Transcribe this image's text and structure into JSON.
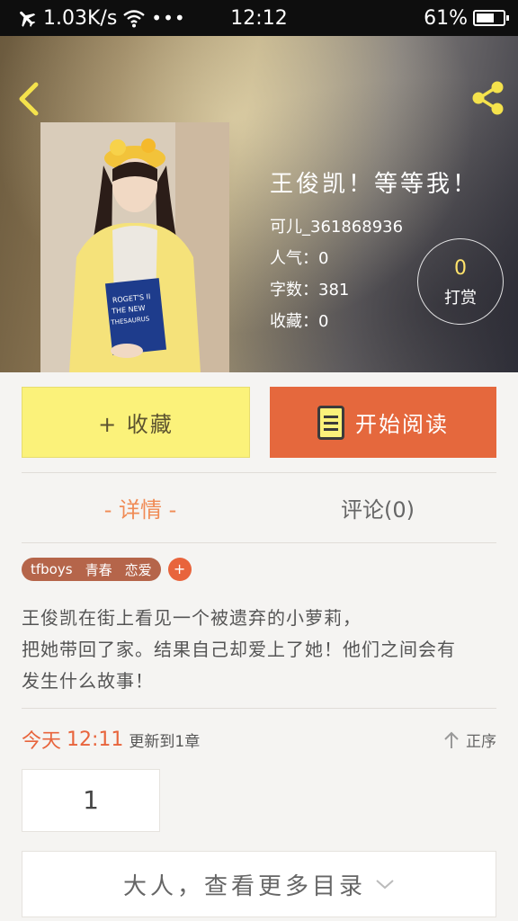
{
  "status": {
    "speed": "1.03K/s",
    "time": "12:12",
    "battery": "61%"
  },
  "book": {
    "title": "王俊凯！等等我！",
    "author": "可儿_361868936",
    "popularity": "人气：0",
    "word_count": "字数：381",
    "favorites": "收藏：0"
  },
  "tip": {
    "count": "0",
    "label": "打赏"
  },
  "actions": {
    "favorite_label": "+ 收藏",
    "read_label": "开始阅读"
  },
  "tabs": {
    "detail": "- 详情 -",
    "comments": "评论(0)"
  },
  "tags": [
    "tfboys",
    "青春",
    "恋爱"
  ],
  "tag_add": "+",
  "synopsis": [
    "王俊凯在街上看见一个被遗弃的小萝莉，",
    "把她带回了家。结果自己却爱上了她！他们之间会有",
    "发生什么故事！"
  ],
  "update": {
    "day": "今天",
    "time": "12:11",
    "text": "更新到1章",
    "order": "正序"
  },
  "page_number": "1",
  "more_catalog": "大人，查看更多目录",
  "colors": {
    "accent": "#e5683d",
    "favorite_bg": "#fbf27a",
    "tag_bg": "#b5654a"
  }
}
